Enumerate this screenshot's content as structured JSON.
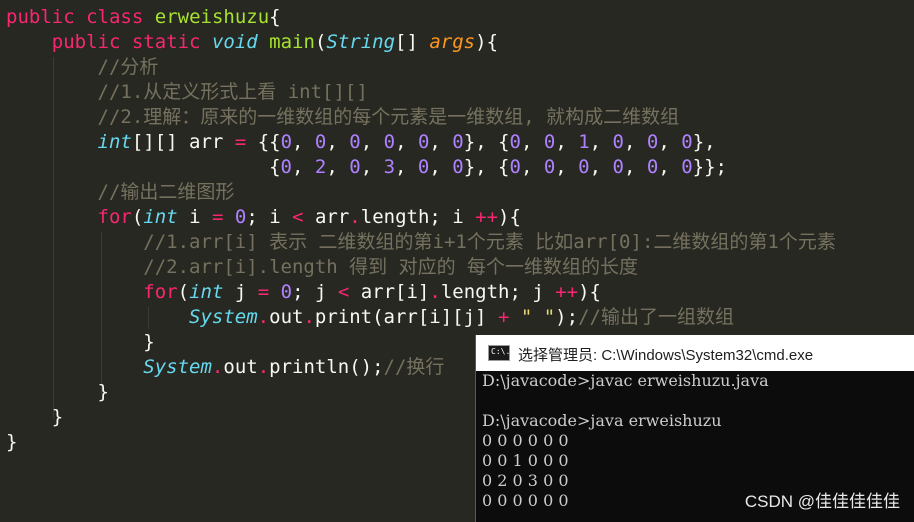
{
  "editor": {
    "lines": [
      [
        {
          "c": "kw",
          "t": "public"
        },
        {
          "c": "pl",
          "t": " "
        },
        {
          "c": "kw",
          "t": "class"
        },
        {
          "c": "pl",
          "t": " "
        },
        {
          "c": "fn",
          "t": "erweishuzu"
        },
        {
          "c": "pl",
          "t": "{"
        }
      ],
      [
        {
          "c": "pl",
          "t": "    "
        },
        {
          "c": "kw",
          "t": "public"
        },
        {
          "c": "pl",
          "t": " "
        },
        {
          "c": "kw",
          "t": "static"
        },
        {
          "c": "pl",
          "t": " "
        },
        {
          "c": "type",
          "t": "void"
        },
        {
          "c": "pl",
          "t": " "
        },
        {
          "c": "fn",
          "t": "main"
        },
        {
          "c": "pl",
          "t": "("
        },
        {
          "c": "type",
          "t": "String"
        },
        {
          "c": "pl",
          "t": "[] "
        },
        {
          "c": "param",
          "t": "args"
        },
        {
          "c": "pl",
          "t": "){"
        }
      ],
      [
        {
          "c": "pl",
          "t": "        "
        },
        {
          "c": "cm",
          "t": "//分析"
        }
      ],
      [
        {
          "c": "pl",
          "t": "        "
        },
        {
          "c": "cm",
          "t": "//1.从定义形式上看 int[][]"
        }
      ],
      [
        {
          "c": "pl",
          "t": "        "
        },
        {
          "c": "cm",
          "t": "//2.理解：原来的一维数组的每个元素是一维数组, 就构成二维数组"
        }
      ],
      [
        {
          "c": "pl",
          "t": "        "
        },
        {
          "c": "type",
          "t": "int"
        },
        {
          "c": "pl",
          "t": "[][] arr "
        },
        {
          "c": "kw",
          "t": "="
        },
        {
          "c": "pl",
          "t": " {{"
        },
        {
          "c": "num",
          "t": "0"
        },
        {
          "c": "pl",
          "t": ", "
        },
        {
          "c": "num",
          "t": "0"
        },
        {
          "c": "pl",
          "t": ", "
        },
        {
          "c": "num",
          "t": "0"
        },
        {
          "c": "pl",
          "t": ", "
        },
        {
          "c": "num",
          "t": "0"
        },
        {
          "c": "pl",
          "t": ", "
        },
        {
          "c": "num",
          "t": "0"
        },
        {
          "c": "pl",
          "t": ", "
        },
        {
          "c": "num",
          "t": "0"
        },
        {
          "c": "pl",
          "t": "}, {"
        },
        {
          "c": "num",
          "t": "0"
        },
        {
          "c": "pl",
          "t": ", "
        },
        {
          "c": "num",
          "t": "0"
        },
        {
          "c": "pl",
          "t": ", "
        },
        {
          "c": "num",
          "t": "1"
        },
        {
          "c": "pl",
          "t": ", "
        },
        {
          "c": "num",
          "t": "0"
        },
        {
          "c": "pl",
          "t": ", "
        },
        {
          "c": "num",
          "t": "0"
        },
        {
          "c": "pl",
          "t": ", "
        },
        {
          "c": "num",
          "t": "0"
        },
        {
          "c": "pl",
          "t": "},"
        }
      ],
      [
        {
          "c": "pl",
          "t": "                       {"
        },
        {
          "c": "num",
          "t": "0"
        },
        {
          "c": "pl",
          "t": ", "
        },
        {
          "c": "num",
          "t": "2"
        },
        {
          "c": "pl",
          "t": ", "
        },
        {
          "c": "num",
          "t": "0"
        },
        {
          "c": "pl",
          "t": ", "
        },
        {
          "c": "num",
          "t": "3"
        },
        {
          "c": "pl",
          "t": ", "
        },
        {
          "c": "num",
          "t": "0"
        },
        {
          "c": "pl",
          "t": ", "
        },
        {
          "c": "num",
          "t": "0"
        },
        {
          "c": "pl",
          "t": "}, {"
        },
        {
          "c": "num",
          "t": "0"
        },
        {
          "c": "pl",
          "t": ", "
        },
        {
          "c": "num",
          "t": "0"
        },
        {
          "c": "pl",
          "t": ", "
        },
        {
          "c": "num",
          "t": "0"
        },
        {
          "c": "pl",
          "t": ", "
        },
        {
          "c": "num",
          "t": "0"
        },
        {
          "c": "pl",
          "t": ", "
        },
        {
          "c": "num",
          "t": "0"
        },
        {
          "c": "pl",
          "t": ", "
        },
        {
          "c": "num",
          "t": "0"
        },
        {
          "c": "pl",
          "t": "}};"
        }
      ],
      [
        {
          "c": "pl",
          "t": "        "
        },
        {
          "c": "cm",
          "t": "//输出二维图形"
        }
      ],
      [
        {
          "c": "pl",
          "t": "        "
        },
        {
          "c": "kw",
          "t": "for"
        },
        {
          "c": "pl",
          "t": "("
        },
        {
          "c": "type",
          "t": "int"
        },
        {
          "c": "pl",
          "t": " i "
        },
        {
          "c": "kw",
          "t": "="
        },
        {
          "c": "pl",
          "t": " "
        },
        {
          "c": "num",
          "t": "0"
        },
        {
          "c": "pl",
          "t": "; i "
        },
        {
          "c": "kw",
          "t": "<"
        },
        {
          "c": "pl",
          "t": " arr"
        },
        {
          "c": "kw",
          "t": "."
        },
        {
          "c": "pl",
          "t": "length; i "
        },
        {
          "c": "kw",
          "t": "++"
        },
        {
          "c": "pl",
          "t": "){"
        }
      ],
      [
        {
          "c": "pl",
          "t": "            "
        },
        {
          "c": "cm",
          "t": "//1.arr[i] 表示 二维数组的第i+1个元素 比如arr[0]:二维数组的第1个元素"
        }
      ],
      [
        {
          "c": "pl",
          "t": "            "
        },
        {
          "c": "cm",
          "t": "//2.arr[i].length 得到 对应的 每个一维数组的长度"
        }
      ],
      [
        {
          "c": "pl",
          "t": "            "
        },
        {
          "c": "kw",
          "t": "for"
        },
        {
          "c": "pl",
          "t": "("
        },
        {
          "c": "type",
          "t": "int"
        },
        {
          "c": "pl",
          "t": " j "
        },
        {
          "c": "kw",
          "t": "="
        },
        {
          "c": "pl",
          "t": " "
        },
        {
          "c": "num",
          "t": "0"
        },
        {
          "c": "pl",
          "t": "; j "
        },
        {
          "c": "kw",
          "t": "<"
        },
        {
          "c": "pl",
          "t": " arr[i]"
        },
        {
          "c": "kw",
          "t": "."
        },
        {
          "c": "pl",
          "t": "length; j "
        },
        {
          "c": "kw",
          "t": "++"
        },
        {
          "c": "pl",
          "t": "){"
        }
      ],
      [
        {
          "c": "pl",
          "t": "                "
        },
        {
          "c": "type",
          "t": "System"
        },
        {
          "c": "kw",
          "t": "."
        },
        {
          "c": "pl",
          "t": "out"
        },
        {
          "c": "kw",
          "t": "."
        },
        {
          "c": "pl",
          "t": "print(arr[i][j] "
        },
        {
          "c": "kw",
          "t": "+"
        },
        {
          "c": "pl",
          "t": " "
        },
        {
          "c": "str",
          "t": "\" \""
        },
        {
          "c": "pl",
          "t": ");"
        },
        {
          "c": "cm",
          "t": "//输出了一组数组"
        }
      ],
      [
        {
          "c": "pl",
          "t": "            }"
        }
      ],
      [
        {
          "c": "pl",
          "t": "            "
        },
        {
          "c": "type",
          "t": "System"
        },
        {
          "c": "kw",
          "t": "."
        },
        {
          "c": "pl",
          "t": "out"
        },
        {
          "c": "kw",
          "t": "."
        },
        {
          "c": "pl",
          "t": "println();"
        },
        {
          "c": "cm",
          "t": "//换行"
        }
      ],
      [
        {
          "c": "pl",
          "t": "        }"
        }
      ],
      [
        {
          "c": "pl",
          "t": "    }"
        }
      ],
      [
        {
          "c": "pl",
          "t": "}"
        }
      ]
    ]
  },
  "cmd": {
    "icon_label": "C:\\.",
    "title": "选择管理员: C:\\Windows\\System32\\cmd.exe",
    "output": "D:\\javacode>javac erweishuzu.java\n\nD:\\javacode>java erweishuzu\n0 0 0 0 0 0\n0 0 1 0 0 0\n0 2 0 3 0 0\n0 0 0 0 0 0"
  },
  "watermark": "CSDN @佳佳佳佳佳",
  "colors": {
    "background": "#272822",
    "keyword": "#f92672",
    "type": "#66d9ef",
    "function": "#a6e22e",
    "parameter": "#fd971f",
    "number": "#ae81ff",
    "string": "#e6db74",
    "comment": "#75715e",
    "text": "#f8f8f2"
  }
}
